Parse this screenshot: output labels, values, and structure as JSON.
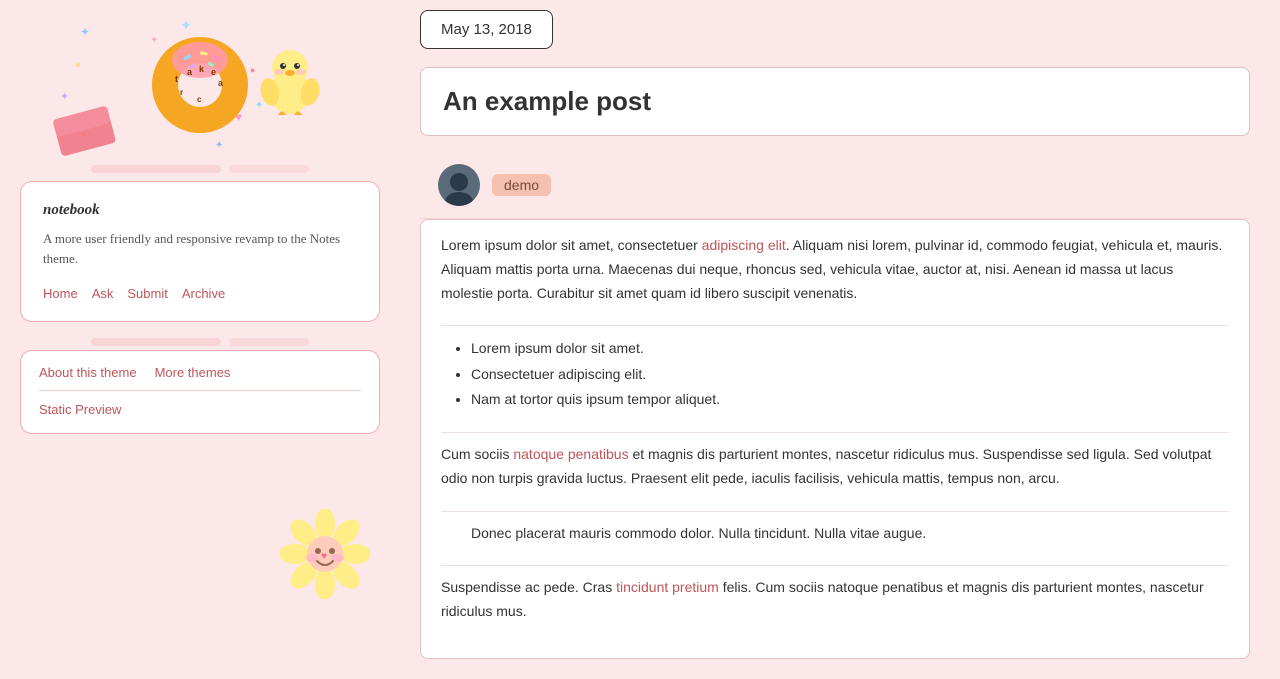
{
  "sidebar": {
    "theme_card": {
      "name": "notebook",
      "description": "A more user friendly and responsive revamp to the Notes theme.",
      "nav_links": [
        "Home",
        "Ask",
        "Submit",
        "Archive"
      ]
    },
    "actions": {
      "about_label": "About this theme",
      "more_themes_label": "More themes",
      "static_preview_label": "Static Preview"
    }
  },
  "main": {
    "date": "May 13, 2018",
    "post_title": "An example post",
    "tag": "demo",
    "body_paragraphs": [
      {
        "type": "text",
        "content_before": "Lorem ipsum dolor sit amet, consectetuer ",
        "link_text": "adipiscing elit",
        "content_after": ". Aliquam nisi lorem, pulvinar id, commodo feugiat, vehicula et, mauris. Aliquam mattis porta urna. Maecenas dui neque, rhoncus sed, vehicula vitae, auctor at, nisi. Aenean id massa ut lacus molestie porta. Curabitur sit amet quam id libero suscipit venenatis."
      },
      {
        "type": "list",
        "items": [
          "Lorem ipsum dolor sit amet.",
          "Consectetuer adipiscing elit.",
          "Nam at tortor quis ipsum tempor aliquet."
        ]
      },
      {
        "type": "text",
        "content_before": "Cum sociis ",
        "link_text": "natoque penatibus",
        "content_after": " et magnis dis parturient montes, nascetur ridiculus mus. Suspendisse sed ligula. Sed volutpat odio non turpis gravida luctus. Praesent elit pede, iaculis facilisis, vehicula mattis, tempus non, arcu."
      },
      {
        "type": "blockquote",
        "content": "Donec placerat mauris commodo dolor. Nulla tincidunt. Nulla vitae augue."
      },
      {
        "type": "text",
        "content_before": "Suspendisse ac pede. Cras ",
        "link_text": "tincidunt pretium",
        "content_after": " felis. Cum sociis natoque penatibus et magnis dis parturient montes, nascetur ridiculus mus."
      }
    ]
  },
  "colors": {
    "link": "#c0555a",
    "border": "#e0c0c0",
    "tag_bg": "#f5c0b0",
    "card_bg": "#ffffff",
    "body_bg": "#fce8e8"
  }
}
